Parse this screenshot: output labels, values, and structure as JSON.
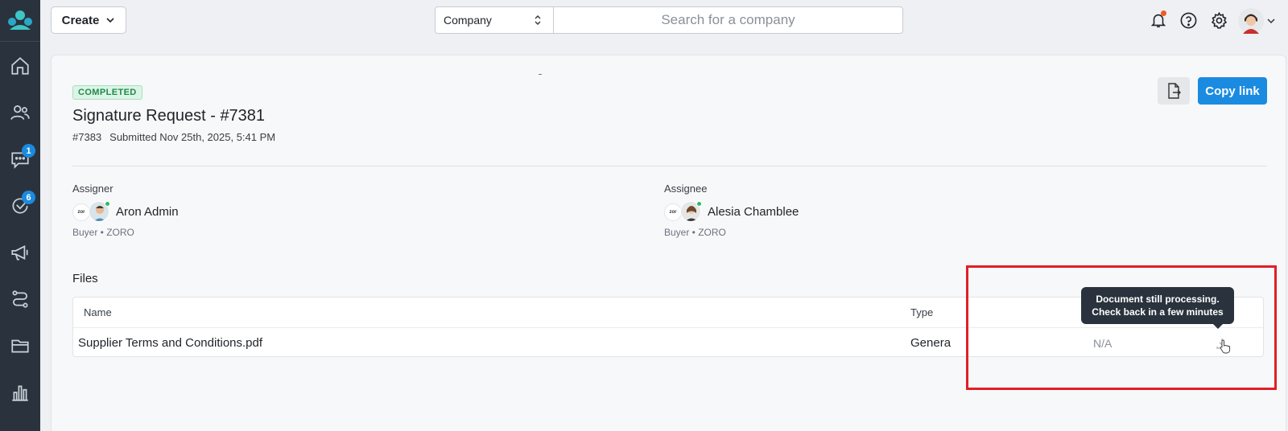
{
  "nav": {
    "items": [
      {
        "name": "home",
        "badge": ""
      },
      {
        "name": "users",
        "badge": ""
      },
      {
        "name": "messages",
        "badge": "1"
      },
      {
        "name": "tasks",
        "badge": "6"
      },
      {
        "name": "announcements",
        "badge": ""
      },
      {
        "name": "workflows",
        "badge": ""
      },
      {
        "name": "files",
        "badge": ""
      },
      {
        "name": "reports",
        "badge": ""
      }
    ]
  },
  "topbar": {
    "create_label": "Create",
    "search_scope": "Company",
    "search_placeholder": "Search for a company"
  },
  "request": {
    "status": "COMPLETED",
    "title": "Signature Request - #7381",
    "id": "#7383",
    "submitted": "Submitted Nov 25th, 2025, 5:41 PM",
    "copy_link_label": "Copy link"
  },
  "assigner": {
    "label": "Assigner",
    "name": "Aron Admin",
    "sub": "Buyer • ZORO",
    "company_logo_text": "zor"
  },
  "assignee": {
    "label": "Assignee",
    "name": "Alesia Chamblee",
    "sub": "Buyer • ZORO",
    "company_logo_text": "zor"
  },
  "files": {
    "title": "Files",
    "columns": {
      "name": "Name",
      "type": "Type"
    },
    "rows": [
      {
        "name": "Supplier Terms and Conditions.pdf",
        "type": "Genera",
        "value": "N/A"
      }
    ]
  },
  "tooltip": {
    "line1": "Document still processing.",
    "line2": "Check back in a few minutes"
  },
  "colors": {
    "accent": "#1a8be0",
    "sidebar": "#2a333d",
    "success": "#1f8a4c",
    "highlight": "#e01f26"
  }
}
